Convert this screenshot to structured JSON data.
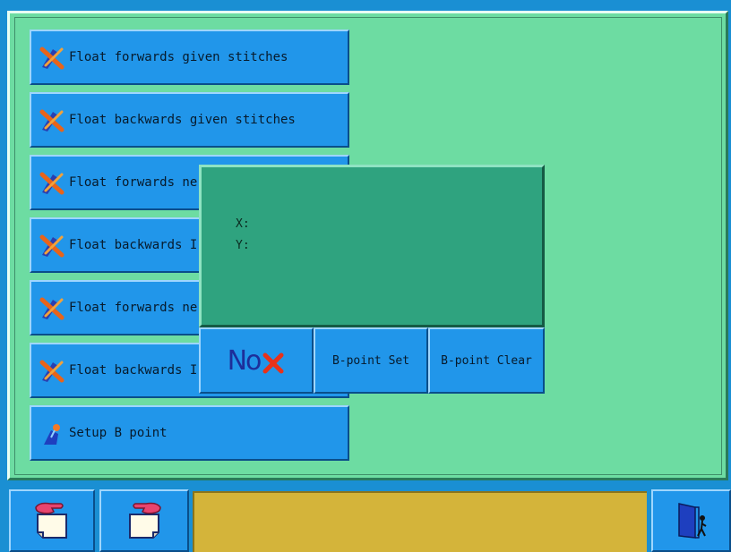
{
  "menu": {
    "items": [
      {
        "label": "Float forwards given stitches",
        "icon": "float-needle-icon"
      },
      {
        "label": "Float backwards given stitches",
        "icon": "float-needle-icon"
      },
      {
        "label": "Float forwards ne",
        "icon": "float-needle-icon"
      },
      {
        "label": "Float backwards I",
        "icon": "float-needle-icon"
      },
      {
        "label": "Float forwards ne",
        "icon": "float-needle-icon"
      },
      {
        "label": "Float backwards I",
        "icon": "float-needle-icon"
      },
      {
        "label": "Setup B point",
        "icon": "setup-point-icon"
      }
    ]
  },
  "dialog": {
    "x_label": "X:",
    "y_label": "Y:",
    "no_label": "No",
    "bpoint_set_label": "B-point Set",
    "bpoint_clear_label": "B-point Clear"
  },
  "toolbar": {
    "status_text": ""
  },
  "colors": {
    "background": "#1a8fd3",
    "panel": "#6ddca2",
    "button": "#2196ea",
    "dialog": "#2fa37f",
    "status": "#d4b43a"
  }
}
